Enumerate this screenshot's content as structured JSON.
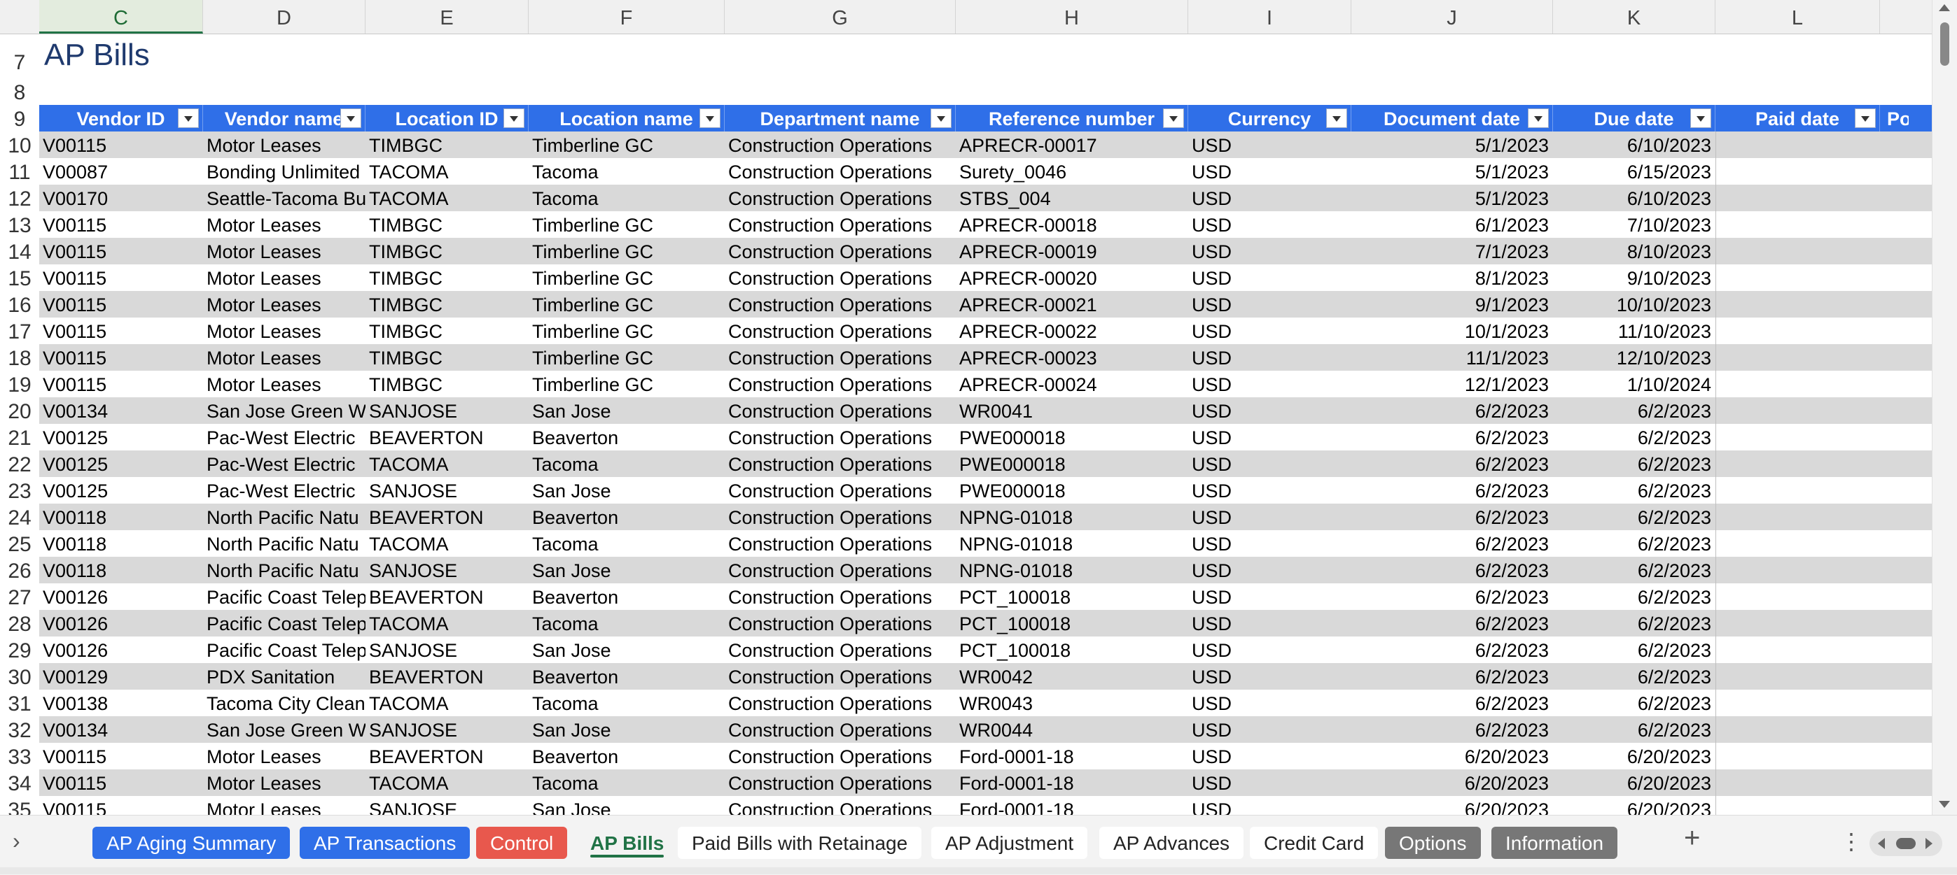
{
  "columns": [
    "C",
    "D",
    "E",
    "F",
    "G",
    "H",
    "I",
    "J",
    "K",
    "L"
  ],
  "selected_column": "C",
  "sheet_title": "AP Bills",
  "title_row": "7",
  "blank_row": "8",
  "header_row": "9",
  "headers": [
    "Vendor ID",
    "Vendor name",
    "Location ID",
    "Location name",
    "Department name",
    "Reference number",
    "Currency",
    "Document date",
    "Due date",
    "Paid date",
    "Po"
  ],
  "rows": [
    {
      "n": "10",
      "c": [
        "V00115",
        "Motor Leases",
        "TIMBGC",
        "Timberline GC",
        "Construction Operations",
        "APRECR-00017",
        "USD",
        "5/1/2023",
        "6/10/2023"
      ]
    },
    {
      "n": "11",
      "c": [
        "V00087",
        "Bonding Unlimited",
        "TACOMA",
        "Tacoma",
        "Construction Operations",
        "Surety_0046",
        "USD",
        "5/1/2023",
        "6/15/2023"
      ]
    },
    {
      "n": "12",
      "c": [
        "V00170",
        "Seattle-Tacoma Bu",
        "TACOMA",
        "Tacoma",
        "Construction Operations",
        "STBS_004",
        "USD",
        "5/1/2023",
        "6/10/2023"
      ]
    },
    {
      "n": "13",
      "c": [
        "V00115",
        "Motor Leases",
        "TIMBGC",
        "Timberline GC",
        "Construction Operations",
        "APRECR-00018",
        "USD",
        "6/1/2023",
        "7/10/2023"
      ]
    },
    {
      "n": "14",
      "c": [
        "V00115",
        "Motor Leases",
        "TIMBGC",
        "Timberline GC",
        "Construction Operations",
        "APRECR-00019",
        "USD",
        "7/1/2023",
        "8/10/2023"
      ]
    },
    {
      "n": "15",
      "c": [
        "V00115",
        "Motor Leases",
        "TIMBGC",
        "Timberline GC",
        "Construction Operations",
        "APRECR-00020",
        "USD",
        "8/1/2023",
        "9/10/2023"
      ]
    },
    {
      "n": "16",
      "c": [
        "V00115",
        "Motor Leases",
        "TIMBGC",
        "Timberline GC",
        "Construction Operations",
        "APRECR-00021",
        "USD",
        "9/1/2023",
        "10/10/2023"
      ]
    },
    {
      "n": "17",
      "c": [
        "V00115",
        "Motor Leases",
        "TIMBGC",
        "Timberline GC",
        "Construction Operations",
        "APRECR-00022",
        "USD",
        "10/1/2023",
        "11/10/2023"
      ]
    },
    {
      "n": "18",
      "c": [
        "V00115",
        "Motor Leases",
        "TIMBGC",
        "Timberline GC",
        "Construction Operations",
        "APRECR-00023",
        "USD",
        "11/1/2023",
        "12/10/2023"
      ]
    },
    {
      "n": "19",
      "c": [
        "V00115",
        "Motor Leases",
        "TIMBGC",
        "Timberline GC",
        "Construction Operations",
        "APRECR-00024",
        "USD",
        "12/1/2023",
        "1/10/2024"
      ]
    },
    {
      "n": "20",
      "c": [
        "V00134",
        "San Jose Green Wa",
        "SANJOSE",
        "San Jose",
        "Construction Operations",
        "WR0041",
        "USD",
        "6/2/2023",
        "6/2/2023"
      ]
    },
    {
      "n": "21",
      "c": [
        "V00125",
        "Pac-West Electric",
        "BEAVERTON",
        "Beaverton",
        "Construction Operations",
        "PWE000018",
        "USD",
        "6/2/2023",
        "6/2/2023"
      ]
    },
    {
      "n": "22",
      "c": [
        "V00125",
        "Pac-West Electric",
        "TACOMA",
        "Tacoma",
        "Construction Operations",
        "PWE000018",
        "USD",
        "6/2/2023",
        "6/2/2023"
      ]
    },
    {
      "n": "23",
      "c": [
        "V00125",
        "Pac-West Electric",
        "SANJOSE",
        "San Jose",
        "Construction Operations",
        "PWE000018",
        "USD",
        "6/2/2023",
        "6/2/2023"
      ]
    },
    {
      "n": "24",
      "c": [
        "V00118",
        "North Pacific Natu",
        "BEAVERTON",
        "Beaverton",
        "Construction Operations",
        "NPNG-01018",
        "USD",
        "6/2/2023",
        "6/2/2023"
      ]
    },
    {
      "n": "25",
      "c": [
        "V00118",
        "North Pacific Natu",
        "TACOMA",
        "Tacoma",
        "Construction Operations",
        "NPNG-01018",
        "USD",
        "6/2/2023",
        "6/2/2023"
      ]
    },
    {
      "n": "26",
      "c": [
        "V00118",
        "North Pacific Natu",
        "SANJOSE",
        "San Jose",
        "Construction Operations",
        "NPNG-01018",
        "USD",
        "6/2/2023",
        "6/2/2023"
      ]
    },
    {
      "n": "27",
      "c": [
        "V00126",
        "Pacific Coast Telep",
        "BEAVERTON",
        "Beaverton",
        "Construction Operations",
        "PCT_100018",
        "USD",
        "6/2/2023",
        "6/2/2023"
      ]
    },
    {
      "n": "28",
      "c": [
        "V00126",
        "Pacific Coast Telep",
        "TACOMA",
        "Tacoma",
        "Construction Operations",
        "PCT_100018",
        "USD",
        "6/2/2023",
        "6/2/2023"
      ]
    },
    {
      "n": "29",
      "c": [
        "V00126",
        "Pacific Coast Telep",
        "SANJOSE",
        "San Jose",
        "Construction Operations",
        "PCT_100018",
        "USD",
        "6/2/2023",
        "6/2/2023"
      ]
    },
    {
      "n": "30",
      "c": [
        "V00129",
        "PDX Sanitation",
        "BEAVERTON",
        "Beaverton",
        "Construction Operations",
        "WR0042",
        "USD",
        "6/2/2023",
        "6/2/2023"
      ]
    },
    {
      "n": "31",
      "c": [
        "V00138",
        "Tacoma City Clean",
        "TACOMA",
        "Tacoma",
        "Construction Operations",
        "WR0043",
        "USD",
        "6/2/2023",
        "6/2/2023"
      ]
    },
    {
      "n": "32",
      "c": [
        "V00134",
        "San Jose Green Wa",
        "SANJOSE",
        "San Jose",
        "Construction Operations",
        "WR0044",
        "USD",
        "6/2/2023",
        "6/2/2023"
      ]
    },
    {
      "n": "33",
      "c": [
        "V00115",
        "Motor Leases",
        "BEAVERTON",
        "Beaverton",
        "Construction Operations",
        "Ford-0001-18",
        "USD",
        "6/20/2023",
        "6/20/2023"
      ]
    },
    {
      "n": "34",
      "c": [
        "V00115",
        "Motor Leases",
        "TACOMA",
        "Tacoma",
        "Construction Operations",
        "Ford-0001-18",
        "USD",
        "6/20/2023",
        "6/20/2023"
      ]
    },
    {
      "n": "35",
      "c": [
        "V00115",
        "Motor Leases",
        "SANJOSE",
        "San Jose",
        "Construction Operations",
        "Ford-0001-18",
        "USD",
        "6/20/2023",
        "6/20/2023"
      ]
    }
  ],
  "tabs": [
    {
      "label": "AP Aging Summary",
      "style": "blue"
    },
    {
      "label": "AP Transactions",
      "style": "blue"
    },
    {
      "label": "Control",
      "style": "red"
    },
    {
      "label": "AP Bills",
      "style": "active"
    },
    {
      "label": "Paid Bills with Retainage",
      "style": "plain"
    },
    {
      "label": "AP Adjustment",
      "style": "plain"
    },
    {
      "label": "AP Advances",
      "style": "plain"
    },
    {
      "label": "Credit Card",
      "style": "plain"
    },
    {
      "label": "Options",
      "style": "gray"
    },
    {
      "label": "Information",
      "style": "gray"
    }
  ],
  "tab_controls": {
    "left_arrow": "›",
    "add": "+",
    "more": "⋮"
  },
  "colors": {
    "header_blue": "#2f6fe8",
    "band_gray": "#d9d9d9",
    "title": "#1f3a6e",
    "active_tab": "#217346",
    "control_red": "#e8584d",
    "option_gray": "#777777"
  },
  "icons": [
    "filter-dropdown-icon",
    "add-sheet-icon",
    "more-options-icon",
    "tab-scroll-left-icon",
    "tab-scroll-right-icon",
    "sheet-nav-arrow-icon"
  ]
}
